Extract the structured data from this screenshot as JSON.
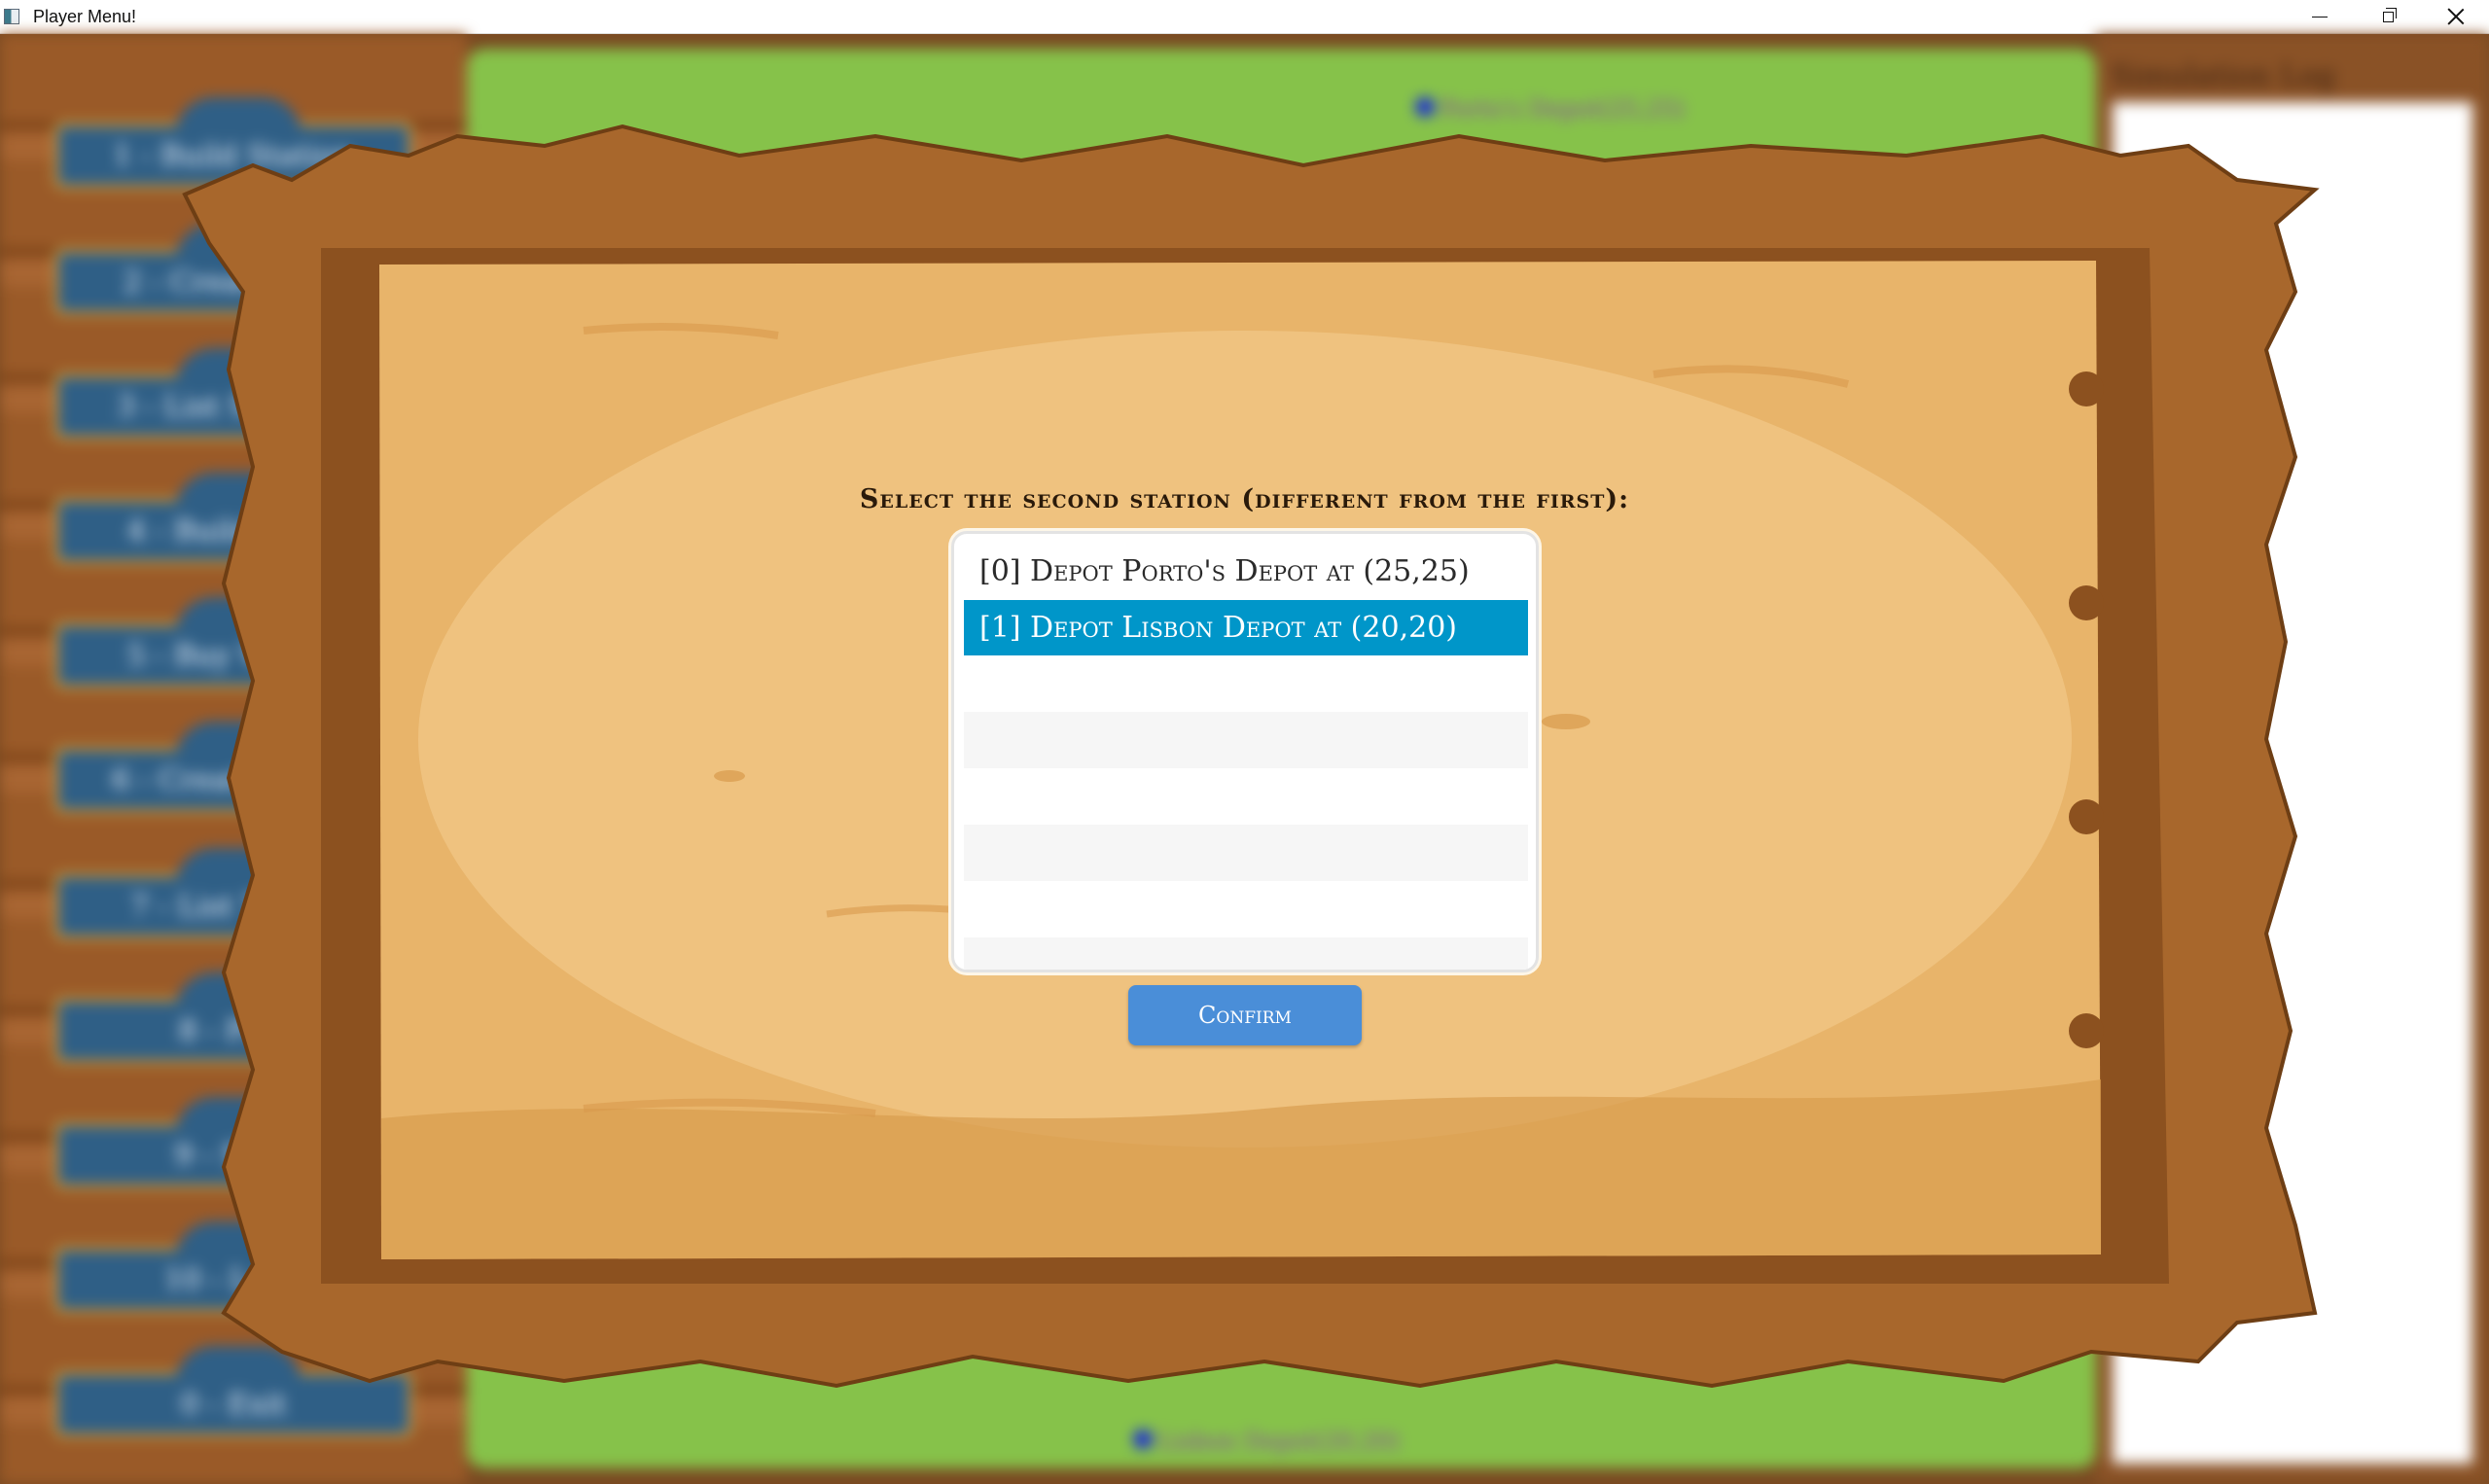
{
  "window": {
    "title": "Player Menu!"
  },
  "background": {
    "log_title": "Simulation Log",
    "menu_items": [
      "1 - Build Station",
      "2 - Create Line",
      "3 - List Stations",
      "4 - Build Train",
      "5 - Buy Wagon",
      "6 - Create Route",
      "7 - List Trains",
      "8 - Play",
      "9 - Save",
      "10 - Load",
      "0 - Exit"
    ],
    "map_stations": [
      {
        "label": "Porto's Depot(25,25)"
      },
      {
        "label": "Lisbon Depot(20,20)"
      }
    ]
  },
  "dialog": {
    "prompt": "Select the second station (different from the first):",
    "options": [
      "[0] Depot Porto's Depot at (25,25)",
      "[1] Depot Lisbon Depot at (20,20)"
    ],
    "selected_index": 1,
    "confirm_label": "Confirm"
  },
  "colors": {
    "selection": "#0096c9",
    "confirm_button": "#4a8ed8",
    "board_parchment": "#e8b46a",
    "board_frame": "#a8672c",
    "menu_button": "#2f5f86",
    "map_grass": "#86c24a"
  }
}
